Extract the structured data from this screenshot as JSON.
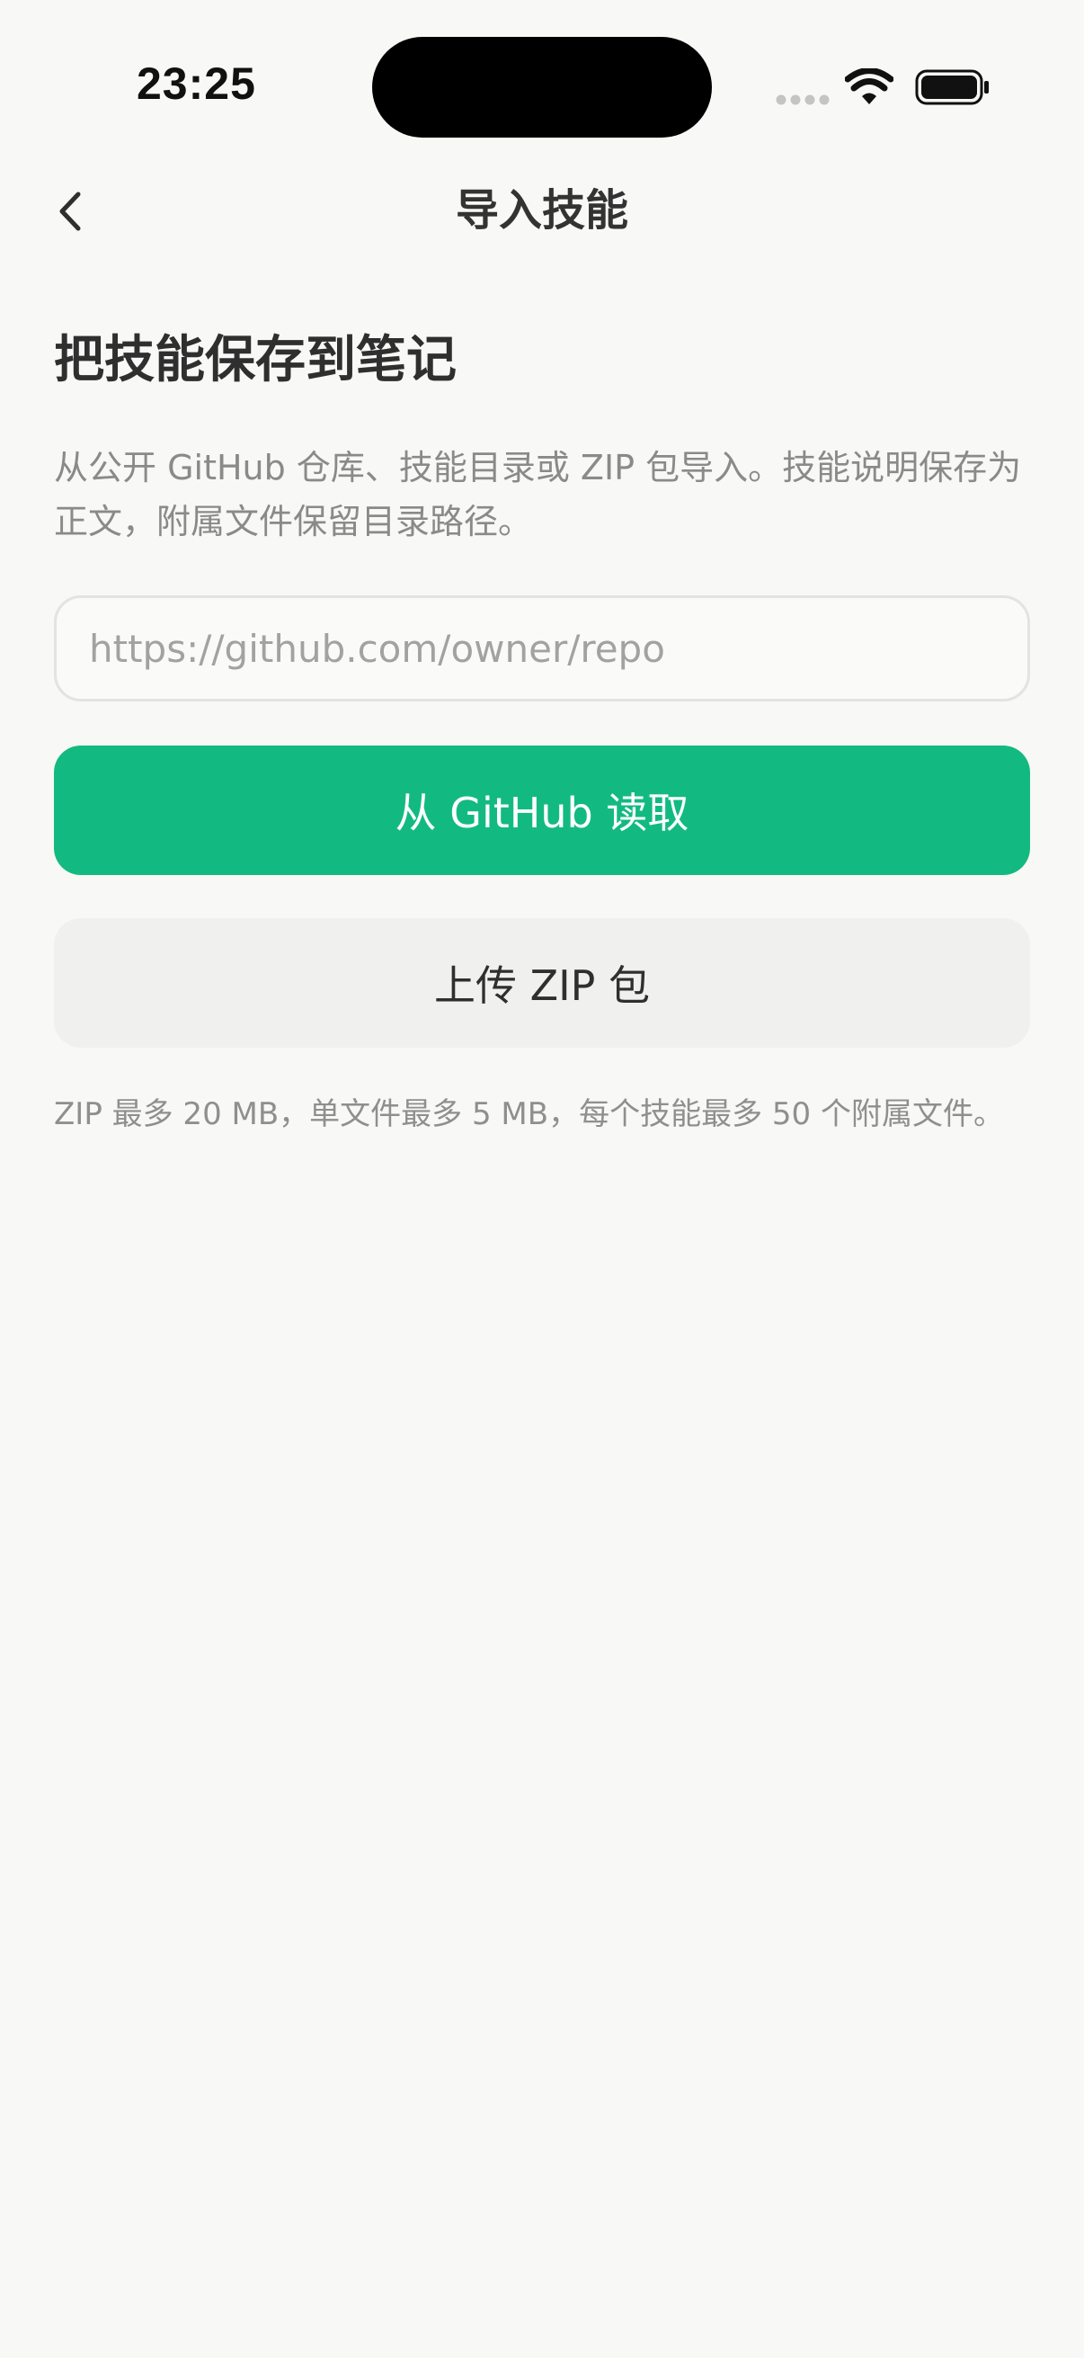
{
  "status_bar": {
    "time": "23:25"
  },
  "nav": {
    "title": "导入技能",
    "back_icon": "chevron-left-icon"
  },
  "main": {
    "heading": "把技能保存到笔记",
    "description": "从公开 GitHub 仓库、技能目录或 ZIP 包导入。技能说明保存为正文，附属文件保留目录路径。",
    "url_input": {
      "value": "",
      "placeholder": "https://github.com/owner/repo"
    },
    "github_button_label": "从 GitHub 读取",
    "zip_button_label": "上传 ZIP 包",
    "limits_hint": "ZIP 最多 20 MB，单文件最多 5 MB，每个技能最多 50 个附属文件。"
  },
  "colors": {
    "primary": "#12ba82",
    "background": "#f8f8f6",
    "secondary_button": "#f0f0ee"
  }
}
